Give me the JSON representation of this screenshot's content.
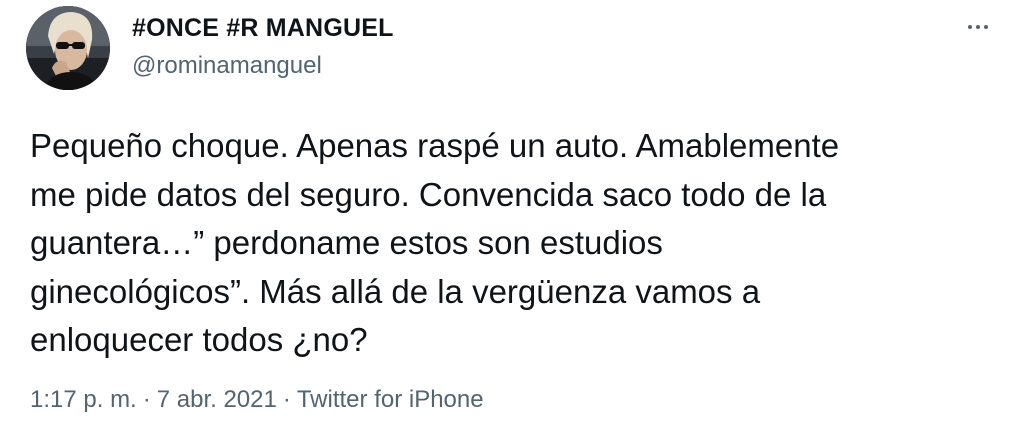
{
  "tweet": {
    "display_name": "#ONCE #R MANGUEL",
    "handle": "@rominamanguel",
    "more_icon": "more-horizontal-icon",
    "text_lines": [
      "Pequeño choque. Apenas raspé un auto. Amablemente",
      "me pide datos del seguro. Convencida saco todo de la",
      "guantera…” perdoname estos son estudios",
      "ginecológicos”. Más allá de la vergüenza vamos a",
      "enloquecer todos ¿no?"
    ],
    "time": "1:17 p. m.",
    "separator": "·",
    "date": "7 abr. 2021",
    "source": "Twitter for iPhone"
  },
  "colors": {
    "text_primary": "#0f1419",
    "text_secondary": "#536471",
    "background": "#ffffff"
  }
}
